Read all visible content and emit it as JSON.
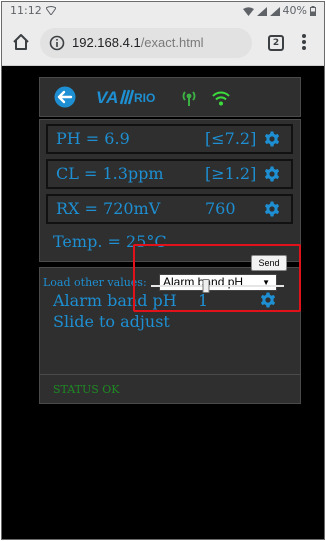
{
  "status_bar": {
    "time": "11:12",
    "battery": "40%"
  },
  "browser": {
    "url_host": "192.168.4.1",
    "url_path": "/exact.html",
    "tab_count": "2"
  },
  "values": {
    "rows": [
      {
        "label": "PH = 6.9",
        "limit": "[≤7.2]"
      },
      {
        "label": "CL = 1.3ppm",
        "limit": "[≥1.2]"
      },
      {
        "label": "RX = 720mV",
        "limit": "760"
      }
    ],
    "temp": "Temp. = 25°C"
  },
  "alarm": {
    "load_label": "Load other values:",
    "select_value": "Alarm band pH",
    "band_label": "Alarm band pH",
    "band_value": "1",
    "slide_label": "Slide to adjust",
    "send_label": "Send",
    "slider_fraction": 0.41
  },
  "status": {
    "text": "STATUS OK"
  },
  "colors": {
    "accent": "#1d8fd2",
    "status_ok": "#1e8a23",
    "highlight": "#e1121a",
    "panel": "#2f2f2f",
    "antenna": "#3cb043",
    "wifi": "#3ddc3d"
  }
}
